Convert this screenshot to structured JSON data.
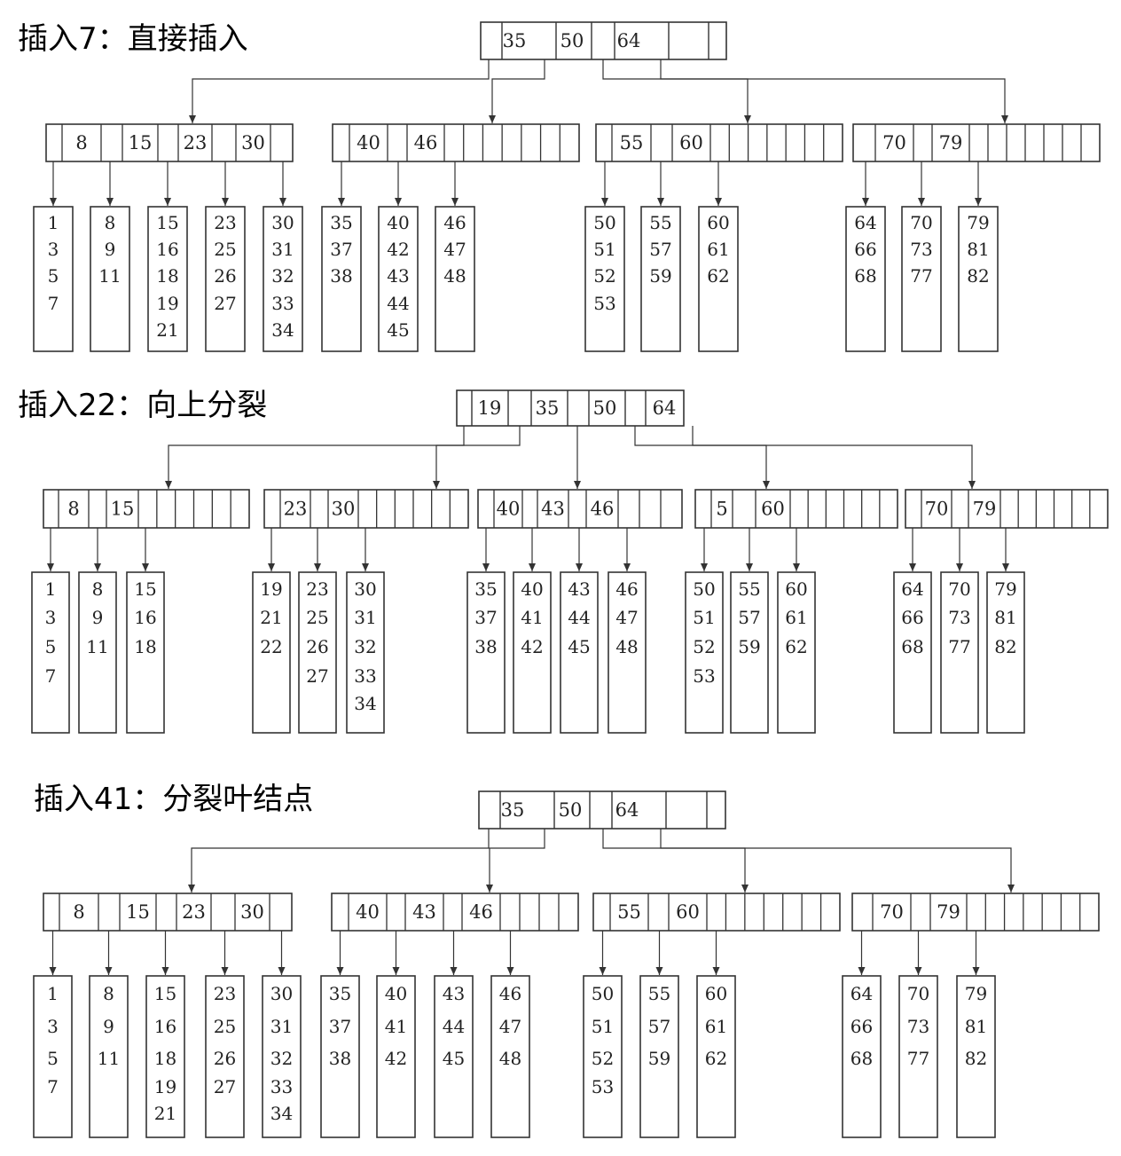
{
  "sections": [
    {
      "title": "插入7：直接插入",
      "root": [
        "35",
        "50",
        "64",
        ""
      ],
      "internal": [
        [
          "8",
          "15",
          "23",
          "30"
        ],
        [
          "40",
          "46",
          "",
          ""
        ],
        [
          "55",
          "60",
          "",
          ""
        ],
        [
          "70",
          "79",
          "",
          ""
        ]
      ],
      "leaves": [
        [
          "1",
          "3",
          "5",
          "7"
        ],
        [
          "8",
          "9",
          "11"
        ],
        [
          "15",
          "16",
          "18",
          "19",
          "21"
        ],
        [
          "23",
          "25",
          "26",
          "27"
        ],
        [
          "30",
          "31",
          "32",
          "33",
          "34"
        ],
        [
          "35",
          "37",
          "38"
        ],
        [
          "40",
          "42",
          "43",
          "44",
          "45"
        ],
        [
          "46",
          "47",
          "48"
        ],
        [
          "50",
          "51",
          "52",
          "53"
        ],
        [
          "55",
          "57",
          "59"
        ],
        [
          "60",
          "61",
          "62"
        ],
        [
          "64",
          "66",
          "68"
        ],
        [
          "70",
          "73",
          "77"
        ],
        [
          "79",
          "81",
          "82"
        ]
      ]
    },
    {
      "title": "插入22：向上分裂",
      "root": [
        "19",
        "35",
        "50",
        "64"
      ],
      "internal": [
        [
          "8",
          "15",
          "",
          ""
        ],
        [
          "23",
          "30",
          "",
          ""
        ],
        [
          "40",
          "43",
          "46",
          ""
        ],
        [
          "5",
          "60",
          "",
          ""
        ],
        [
          "70",
          "79",
          "",
          ""
        ]
      ],
      "leaves": [
        [
          "1",
          "3",
          "5",
          "7"
        ],
        [
          "8",
          "9",
          "11"
        ],
        [
          "15",
          "16",
          "18"
        ],
        [
          "19",
          "21",
          "22"
        ],
        [
          "23",
          "25",
          "26",
          "27"
        ],
        [
          "30",
          "31",
          "32",
          "33",
          "34"
        ],
        [
          "35",
          "37",
          "38"
        ],
        [
          "40",
          "41",
          "42"
        ],
        [
          "43",
          "44",
          "45"
        ],
        [
          "46",
          "47",
          "48"
        ],
        [
          "50",
          "51",
          "52",
          "53"
        ],
        [
          "55",
          "57",
          "59"
        ],
        [
          "60",
          "61",
          "62"
        ],
        [
          "64",
          "66",
          "68"
        ],
        [
          "70",
          "73",
          "77"
        ],
        [
          "79",
          "81",
          "82"
        ]
      ]
    },
    {
      "title": "插入41：分裂叶结点",
      "root": [
        "35",
        "50",
        "64",
        ""
      ],
      "internal": [
        [
          "8",
          "15",
          "23",
          "30"
        ],
        [
          "40",
          "43",
          "46",
          ""
        ],
        [
          "55",
          "60",
          "",
          ""
        ],
        [
          "70",
          "79",
          "",
          ""
        ]
      ],
      "leaves": [
        [
          "1",
          "3",
          "5",
          "7"
        ],
        [
          "8",
          "9",
          "11"
        ],
        [
          "15",
          "16",
          "18",
          "19",
          "21"
        ],
        [
          "23",
          "25",
          "26",
          "27"
        ],
        [
          "30",
          "31",
          "32",
          "33",
          "34"
        ],
        [
          "35",
          "37",
          "38"
        ],
        [
          "40",
          "41",
          "42"
        ],
        [
          "43",
          "44",
          "45"
        ],
        [
          "46",
          "47",
          "48"
        ],
        [
          "50",
          "51",
          "52",
          "53"
        ],
        [
          "55",
          "57",
          "59"
        ],
        [
          "60",
          "61",
          "62"
        ],
        [
          "64",
          "66",
          "68"
        ],
        [
          "70",
          "73",
          "77"
        ],
        [
          "79",
          "81",
          "82"
        ]
      ]
    }
  ]
}
